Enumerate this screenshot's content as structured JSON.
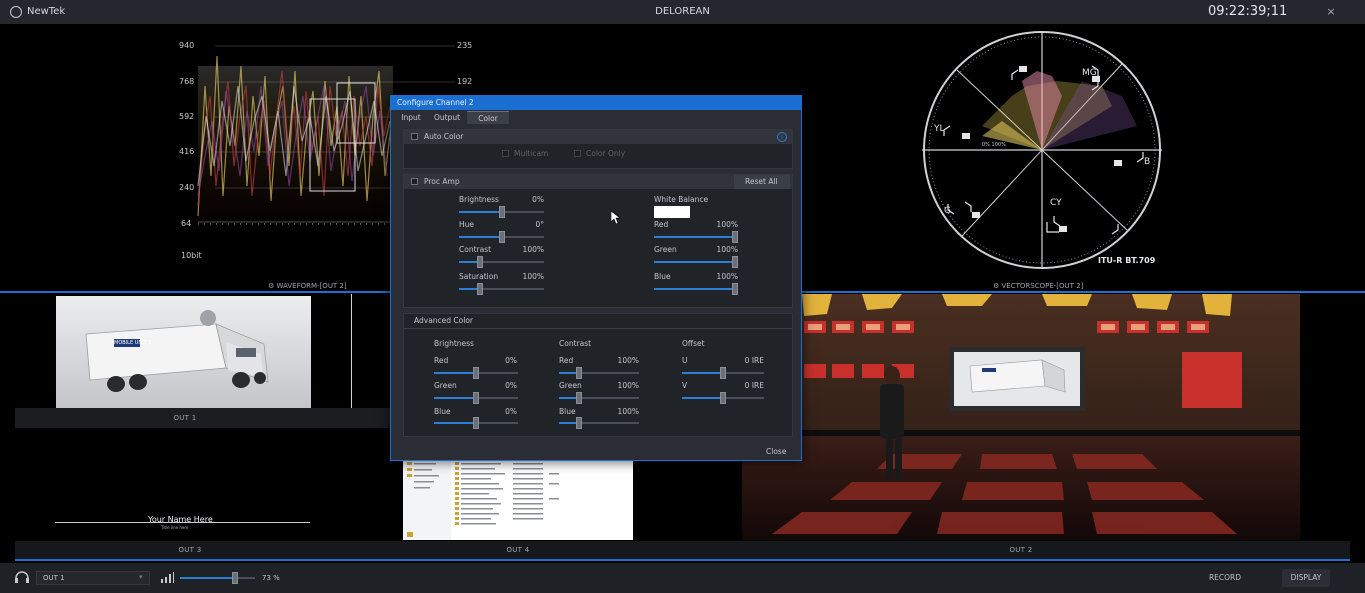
{
  "window": {
    "app_name": "NewTek",
    "title": "DELOREAN",
    "clock": "09:22:39;11",
    "close_glyph": "×"
  },
  "scopes": {
    "waveform_label": "WAVEFORM-[OUT 2]",
    "waveform_left_ticks": [
      "940",
      "768",
      "592",
      "416",
      "240",
      "64"
    ],
    "waveform_right_ticks": [
      "235",
      "192"
    ],
    "waveform_bitdepth": "10bit",
    "vectorscope_label": "VECTORSCOPE-[OUT 2]",
    "vectorscope_standard": "ITU-R BT.709",
    "vectorscope_targets": [
      "MG",
      "YL",
      "B",
      "G",
      "CY"
    ],
    "vectorscope_skin": "0% 100%"
  },
  "outputs": {
    "out1": "OUT 1",
    "out2": "OUT 2",
    "out3": "OUT 3",
    "out4": "OUT 4",
    "truck_text": "MOBILE UNIT 1",
    "lower_third_name": "Your Name Here",
    "lower_third_sub": "Title line here"
  },
  "dialog": {
    "title": "Configure Channel 2",
    "tabs": [
      "Input",
      "Output",
      "Color"
    ],
    "active_tab": "Color",
    "auto_color": {
      "label": "Auto Color",
      "multicam": "Multicam",
      "color_only": "Color Only",
      "info_icon": "i"
    },
    "proc_amp": {
      "label": "Proc Amp",
      "reset_all": "Reset All",
      "brightness": {
        "label": "Brightness",
        "value": "0%",
        "level": 0.5
      },
      "hue": {
        "label": "Hue",
        "value": "0°",
        "level": 0.5
      },
      "contrast": {
        "label": "Contrast",
        "value": "100%",
        "level": 0.25
      },
      "saturation": {
        "label": "Saturation",
        "value": "100%",
        "level": 0.25
      },
      "white_balance": {
        "label": "White Balance",
        "swatch": "#ffffff"
      },
      "red": {
        "label": "Red",
        "value": "100%",
        "level": 1.0
      },
      "green": {
        "label": "Green",
        "value": "100%",
        "level": 1.0
      },
      "blue": {
        "label": "Blue",
        "value": "100%",
        "level": 1.0
      }
    },
    "advanced": {
      "label": "Advanced Color",
      "brightness_head": "Brightness",
      "contrast_head": "Contrast",
      "offset_head": "Offset",
      "b_red": {
        "label": "Red",
        "value": "0%",
        "level": 0.5
      },
      "b_green": {
        "label": "Green",
        "value": "0%",
        "level": 0.5
      },
      "b_blue": {
        "label": "Blue",
        "value": "0%",
        "level": 0.5
      },
      "c_red": {
        "label": "Red",
        "value": "100%",
        "level": 0.25
      },
      "c_green": {
        "label": "Green",
        "value": "100%",
        "level": 0.25
      },
      "c_blue": {
        "label": "Blue",
        "value": "100%",
        "level": 0.25
      },
      "o_u": {
        "label": "U",
        "value": "0 IRE",
        "level": 0.5
      },
      "o_v": {
        "label": "V",
        "value": "0 IRE",
        "level": 0.5
      }
    },
    "close": "Close"
  },
  "footer": {
    "audio_output": "OUT 1",
    "volume": "73 %",
    "volume_level": 0.73,
    "record": "RECORD",
    "display": "DISPLAY"
  },
  "colors": {
    "accent": "#1b6fd0",
    "titlebar": "#24272d",
    "dialog_bg": "#2a2d33"
  }
}
